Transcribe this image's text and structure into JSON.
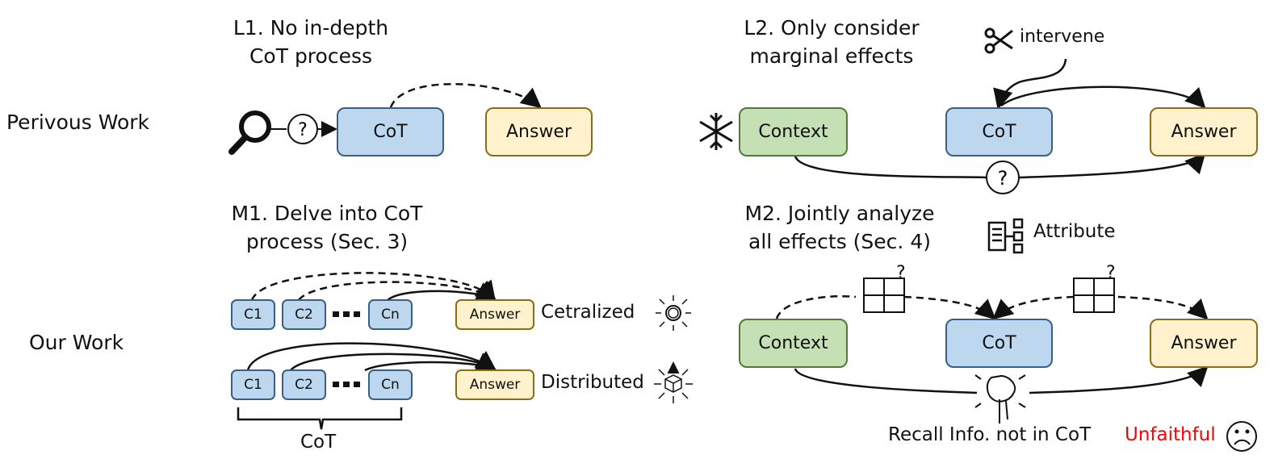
{
  "rows": {
    "previous": "Perivous Work",
    "ours": "Our Work"
  },
  "panels": {
    "L1": {
      "title_line1": "L1. No in-depth",
      "title_line2": "CoT process",
      "nodes": {
        "cot": "CoT",
        "answer": "Answer"
      },
      "icons": [
        "magnifier-icon",
        "question-icon"
      ]
    },
    "L2": {
      "title_line1": "L2. Only consider",
      "title_line2": "marginal effects",
      "nodes": {
        "context": "Context",
        "cot": "CoT",
        "answer": "Answer"
      },
      "intervene_label": "intervene",
      "icons": [
        "snowflake-icon",
        "scissors-icon",
        "question-icon"
      ]
    },
    "M1": {
      "title_line1": "M1. Delve into CoT",
      "title_line2": "process (Sec. 3)",
      "steps": [
        "C1",
        "C2",
        "Cn"
      ],
      "answer": "Answer",
      "centralized_label": "Cetralized",
      "distributed_label": "Distributed",
      "brace_label": "CoT",
      "icons": [
        "centralized-icon",
        "distributed-icon"
      ]
    },
    "M2": {
      "title_line1": "M2. Jointly analyze",
      "title_line2": "all effects (Sec. 4)",
      "attribute_label": "Attribute",
      "nodes": {
        "context": "Context",
        "cot": "CoT",
        "answer": "Answer"
      },
      "recall_label": "Recall Info. not in CoT",
      "unfaithful_label": "Unfaithful",
      "icons": [
        "attribute-icon",
        "puzzle-question-icon",
        "puzzle-hand-icon",
        "sad-face-icon"
      ]
    }
  },
  "colors": {
    "cot_fill": "#bdd7ee",
    "answer_fill": "#fff2cc",
    "context_fill": "#c5e0b4",
    "unfaithful": "#ff0000"
  }
}
